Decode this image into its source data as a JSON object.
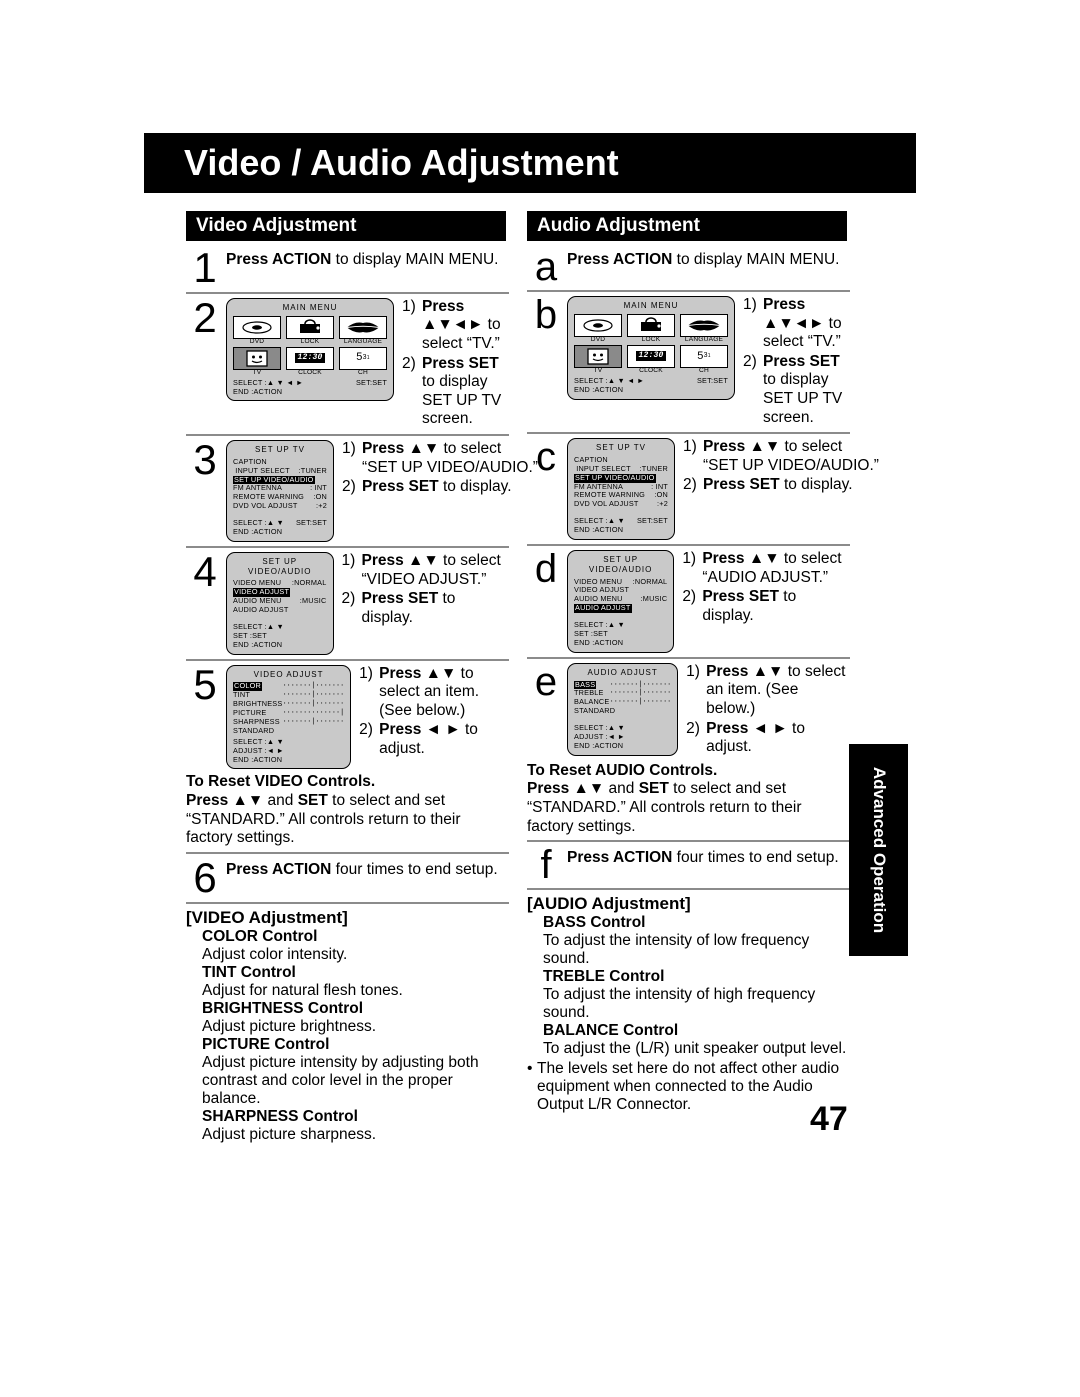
{
  "page": {
    "title": "Video / Audio Adjustment",
    "number": "47",
    "side_tab": "Advanced Operation"
  },
  "columns": {
    "video": {
      "heading": "Video Adjustment",
      "steps": [
        {
          "marker": "1",
          "lead_bold": "Press ACTION",
          "lead_rest": " to display MAIN MENU."
        },
        {
          "marker": "2"
        },
        {
          "marker": "3"
        },
        {
          "marker": "4"
        },
        {
          "marker": "5"
        },
        {
          "marker": "6",
          "lead_bold": "Press ACTION",
          "lead_rest": " four times to end setup."
        }
      ],
      "instructions": {
        "step2": {
          "i1_n": "1)",
          "i1_b": "Press ▲▼◄►",
          "i1_t": " to select “TV.”",
          "i2_n": "2)",
          "i2_b": "Press SET",
          "i2_t": " to display SET UP TV screen."
        },
        "step3": {
          "i1_n": "1)",
          "i1_b": "Press ▲▼",
          "i1_t": " to select “SET UP VIDEO/AUDIO.”",
          "i2_n": "2)",
          "i2_b": "Press SET",
          "i2_t": " to display."
        },
        "step4": {
          "i1_n": "1)",
          "i1_b": "Press ▲▼",
          "i1_t": " to select “VIDEO ADJUST.”",
          "i2_n": "2)",
          "i2_b": "Press SET",
          "i2_t": " to display."
        },
        "step5": {
          "i1_n": "1)",
          "i1_b": "Press ▲▼",
          "i1_t": " to select an item. (See below.)",
          "i2_n": "2)",
          "i2_b": "Press ◄ ►",
          "i2_t": " to adjust."
        }
      },
      "reset": {
        "head": "To Reset VIDEO Controls.",
        "l1_b": "Press ▲▼",
        "l1_m": " and ",
        "l1_b2": "SET",
        "l1_t": " to select and set",
        "l2": "“STANDARD.” All controls return to their",
        "l3": "factory settings."
      },
      "section_title": "[VIDEO Adjustment]",
      "controls": [
        {
          "name": "COLOR Control",
          "desc": "Adjust color intensity."
        },
        {
          "name": "TINT Control",
          "desc": "Adjust for natural flesh tones."
        },
        {
          "name": "BRIGHTNESS Control",
          "desc": "Adjust picture brightness."
        },
        {
          "name": "PICTURE Control",
          "desc": "Adjust picture intensity by adjusting both contrast and color level in the proper balance."
        },
        {
          "name": "SHARPNESS Control",
          "desc": "Adjust picture sharpness."
        }
      ]
    },
    "audio": {
      "heading": "Audio Adjustment",
      "steps": [
        {
          "marker": "a",
          "lead_bold": "Press ACTION",
          "lead_rest": " to display MAIN MENU."
        },
        {
          "marker": "b"
        },
        {
          "marker": "c"
        },
        {
          "marker": "d"
        },
        {
          "marker": "e"
        },
        {
          "marker": "f",
          "lead_bold": "Press ACTION",
          "lead_rest": " four times to end setup."
        }
      ],
      "instructions": {
        "stepb": {
          "i1_n": "1)",
          "i1_b": "Press ▲▼◄►",
          "i1_t": " to select “TV.”",
          "i2_n": "2)",
          "i2_b": "Press SET",
          "i2_t": " to display SET UP TV screen."
        },
        "stepc": {
          "i1_n": "1)",
          "i1_b": "Press ▲▼",
          "i1_t": " to select “SET UP VIDEO/AUDIO.”",
          "i2_n": "2)",
          "i2_b": "Press SET",
          "i2_t": " to display."
        },
        "stepd": {
          "i1_n": "1)",
          "i1_b": "Press ▲▼",
          "i1_t": " to select “AUDIO ADJUST.”",
          "i2_n": "2)",
          "i2_b": "Press SET",
          "i2_t": " to display."
        },
        "stepe": {
          "i1_n": "1)",
          "i1_b": "Press ▲▼",
          "i1_t": " to select an item. (See below.)",
          "i2_n": "2)",
          "i2_b": "Press ◄ ►",
          "i2_t": " to adjust."
        }
      },
      "reset": {
        "head": "To Reset AUDIO Controls.",
        "l1_b": "Press ▲▼",
        "l1_m": " and ",
        "l1_b2": "SET",
        "l1_t": " to select and set",
        "l2": "“STANDARD.” All controls return to their",
        "l3": "factory settings."
      },
      "section_title": "[AUDIO Adjustment]",
      "controls": [
        {
          "name": "BASS Control",
          "desc": "To adjust the intensity of low frequency sound."
        },
        {
          "name": "TREBLE Control",
          "desc": "To adjust the intensity of high frequency sound."
        },
        {
          "name": "BALANCE Control",
          "desc": "To adjust the (L/R) unit speaker output level."
        }
      ],
      "note_bullet": "•",
      "note": "The levels set here do not affect other audio equipment when connected to the Audio Output L/R Connector."
    }
  },
  "osd": {
    "main_menu": {
      "title": "MAIN MENU",
      "cells": [
        {
          "label": "DVD",
          "icon": "dvd-disc-icon",
          "selected": false
        },
        {
          "label": "LOCK",
          "icon": "lock-icon",
          "selected": false
        },
        {
          "label": "LANGUAGE",
          "icon": "lips-language-icon",
          "selected": false
        },
        {
          "label": "TV",
          "icon": "tv-icon",
          "selected": true
        },
        {
          "label": "CLOCK",
          "icon": "clock-icon",
          "selected": false
        },
        {
          "label": "CH",
          "icon": "channel-icon",
          "selected": false
        }
      ],
      "clock_value": "12:30",
      "ch_value": "5",
      "ch_sup1": "3",
      "ch_sup2": "1",
      "foot_select": "SELECT :▲ ▼ ◄ ►",
      "foot_set": "SET:SET",
      "foot_end": "END     :ACTION"
    },
    "set_up_tv": {
      "title": "SET UP TV",
      "rows": [
        {
          "label": "CAPTION",
          "value": "",
          "highlight": false
        },
        {
          "label": " INPUT SELECT",
          "value": ":TUNER",
          "highlight": false
        },
        {
          "label": "SET UP VIDEO/AUDIO",
          "value": "",
          "highlight": true
        },
        {
          "label": "FM ANTENNA",
          "value": ": INT",
          "highlight": false
        },
        {
          "label": "REMOTE WARNING",
          "value": ":ON",
          "highlight": false
        },
        {
          "label": "DVD VOL ADJUST",
          "value": ":+2",
          "highlight": false
        }
      ],
      "foot_select": "SELECT :▲ ▼",
      "foot_set": "SET:SET",
      "foot_end": "END     :ACTION"
    },
    "set_up_va_video": {
      "title": "SET UP VIDEO/AUDIO",
      "rows": [
        {
          "label": "VIDEO MENU",
          "value": ":NORMAL",
          "highlight": false
        },
        {
          "label": "VIDEO ADJUST",
          "value": "",
          "highlight": true
        },
        {
          "label": "AUDIO MENU",
          "value": ":MUSIC",
          "highlight": false
        },
        {
          "label": "AUDIO ADJUST",
          "value": "",
          "highlight": false
        }
      ],
      "foot_select": "SELECT :▲ ▼",
      "foot_set": "SET       :SET",
      "foot_end": "END      :ACTION"
    },
    "set_up_va_audio": {
      "title": "SET UP VIDEO/AUDIO",
      "rows": [
        {
          "label": "VIDEO MENU",
          "value": ":NORMAL",
          "highlight": false
        },
        {
          "label": "VIDEO ADJUST",
          "value": "",
          "highlight": false
        },
        {
          "label": "AUDIO MENU",
          "value": ":MUSIC",
          "highlight": false
        },
        {
          "label": "AUDIO ADJUST",
          "value": "",
          "highlight": true
        }
      ],
      "foot_select": "SELECT :▲ ▼",
      "foot_set": "SET       :SET",
      "foot_end": "END      :ACTION"
    },
    "video_adjust": {
      "title": "VIDEO ADJUST",
      "rows": [
        {
          "label": "COLOR",
          "bar": "·······|·······",
          "highlight": true
        },
        {
          "label": "TINT",
          "bar": "·······|·······",
          "highlight": false
        },
        {
          "label": "BRIGHTNESS",
          "bar": "·······|·······",
          "highlight": false
        },
        {
          "label": "PICTURE",
          "bar": "··············|",
          "highlight": false
        },
        {
          "label": "SHARPNESS",
          "bar": "·······|·······",
          "highlight": false
        },
        {
          "label": "STANDARD",
          "bar": "",
          "highlight": false
        }
      ],
      "foot_select": "SELECT :▲ ▼",
      "foot_adjust": "ADJUST :◄ ►",
      "foot_end": "END       :ACTION"
    },
    "audio_adjust": {
      "title": "AUDIO ADJUST",
      "rows": [
        {
          "label": "BASS",
          "bar": "·······|·······",
          "highlight": true
        },
        {
          "label": "TREBLE",
          "bar": "·······|·······",
          "highlight": false
        },
        {
          "label": "BALANCE",
          "bar": "·······|·······",
          "highlight": false
        },
        {
          "label": "STANDARD",
          "bar": "",
          "highlight": false
        }
      ],
      "foot_select": "SELECT :▲ ▼",
      "foot_adjust": "ADJUST :◄ ►",
      "foot_end": "END       :ACTION"
    }
  }
}
